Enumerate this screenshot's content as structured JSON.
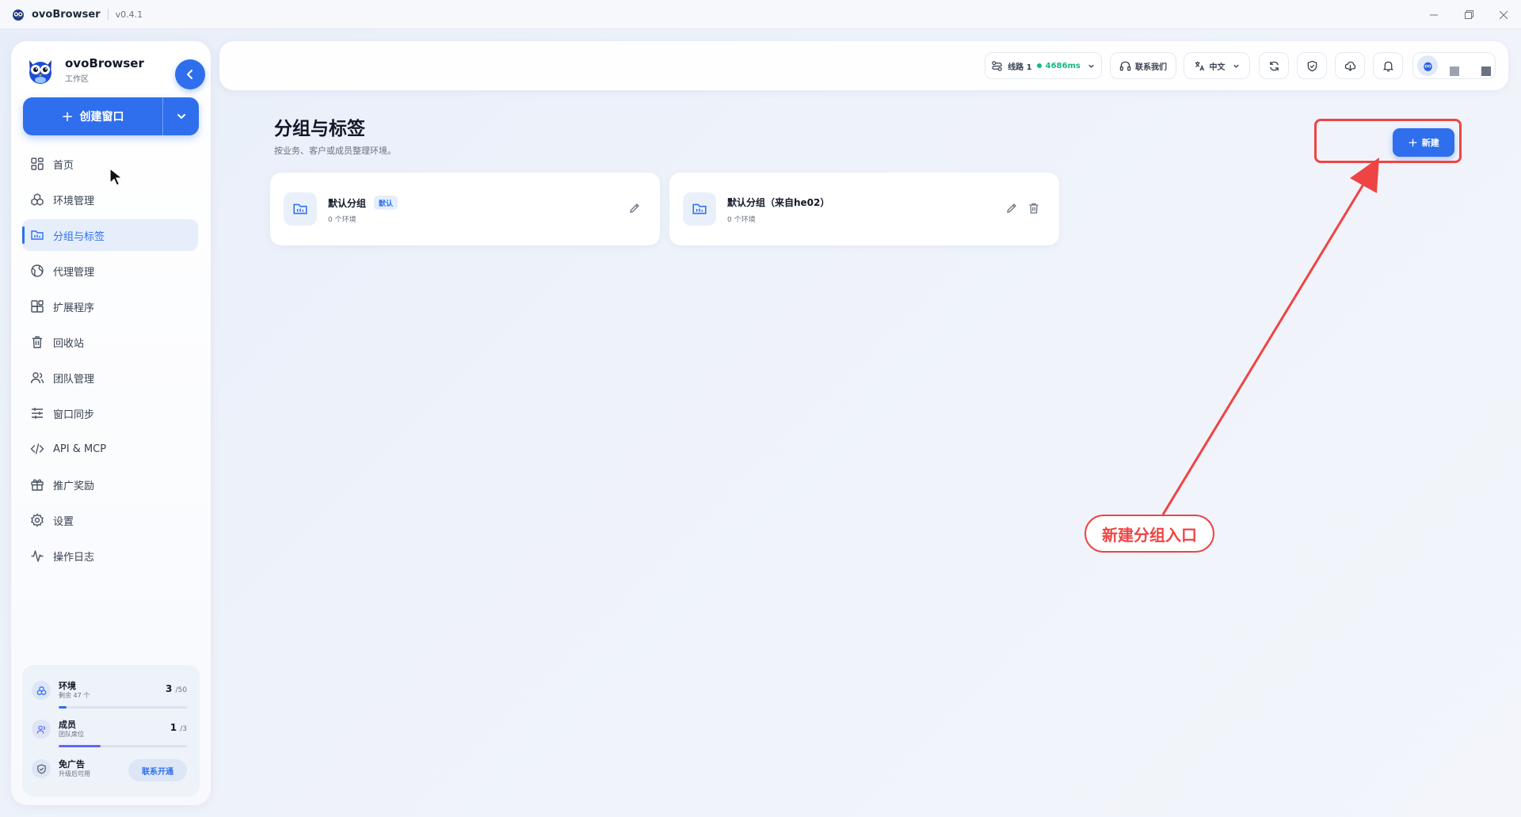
{
  "window": {
    "app_name": "ovoBrowser",
    "version": "v0.4.1",
    "controls": [
      "minimize",
      "restore",
      "close"
    ]
  },
  "sidebar": {
    "brand_name": "ovoBrowser",
    "brand_sub": "工作区",
    "create_button": "创建窗口",
    "nav": [
      {
        "label": "首页",
        "icon": "grid-icon"
      },
      {
        "label": "环境管理",
        "icon": "cubes-icon"
      },
      {
        "label": "分组与标签",
        "icon": "folder-tag-icon",
        "active": true
      },
      {
        "label": "代理管理",
        "icon": "globe-icon"
      },
      {
        "label": "扩展程序",
        "icon": "puzzle-icon"
      },
      {
        "label": "回收站",
        "icon": "trash-icon"
      },
      {
        "label": "团队管理",
        "icon": "users-icon"
      },
      {
        "label": "窗口同步",
        "icon": "sliders-icon"
      },
      {
        "label": "API & MCP",
        "icon": "code-icon"
      },
      {
        "label": "推广奖励",
        "icon": "gift-icon"
      },
      {
        "label": "设置",
        "icon": "gear-icon"
      },
      {
        "label": "操作日志",
        "icon": "activity-icon"
      }
    ],
    "stats": {
      "env": {
        "title": "环境",
        "sub": "剩余 47 个",
        "count": "3",
        "total": "/50",
        "progress": 0.06
      },
      "members": {
        "title": "成员",
        "sub": "团队席位",
        "count": "1",
        "total": "/3",
        "progress": 0.33
      },
      "ads": {
        "title": "免广告",
        "sub": "升级后可用",
        "button": "联系开通"
      }
    }
  },
  "topbar": {
    "line_label": "线路 1",
    "latency": "4686ms",
    "contact": "联系我们",
    "language": "中文",
    "status_color": "#10b981"
  },
  "main": {
    "title": "分组与标签",
    "subtitle": "按业务、客户或成员整理环境。",
    "new_button": "新建",
    "groups": [
      {
        "name": "默认分组",
        "badge": "默认",
        "count": "0 个环境"
      },
      {
        "name": "默认分组（来自he02）",
        "count": "0 个环境"
      }
    ]
  },
  "annotation": {
    "label": "新建分组入口",
    "color": "#ef4444"
  },
  "colors": {
    "accent": "#2f6fed",
    "background": "#eef2fa"
  }
}
